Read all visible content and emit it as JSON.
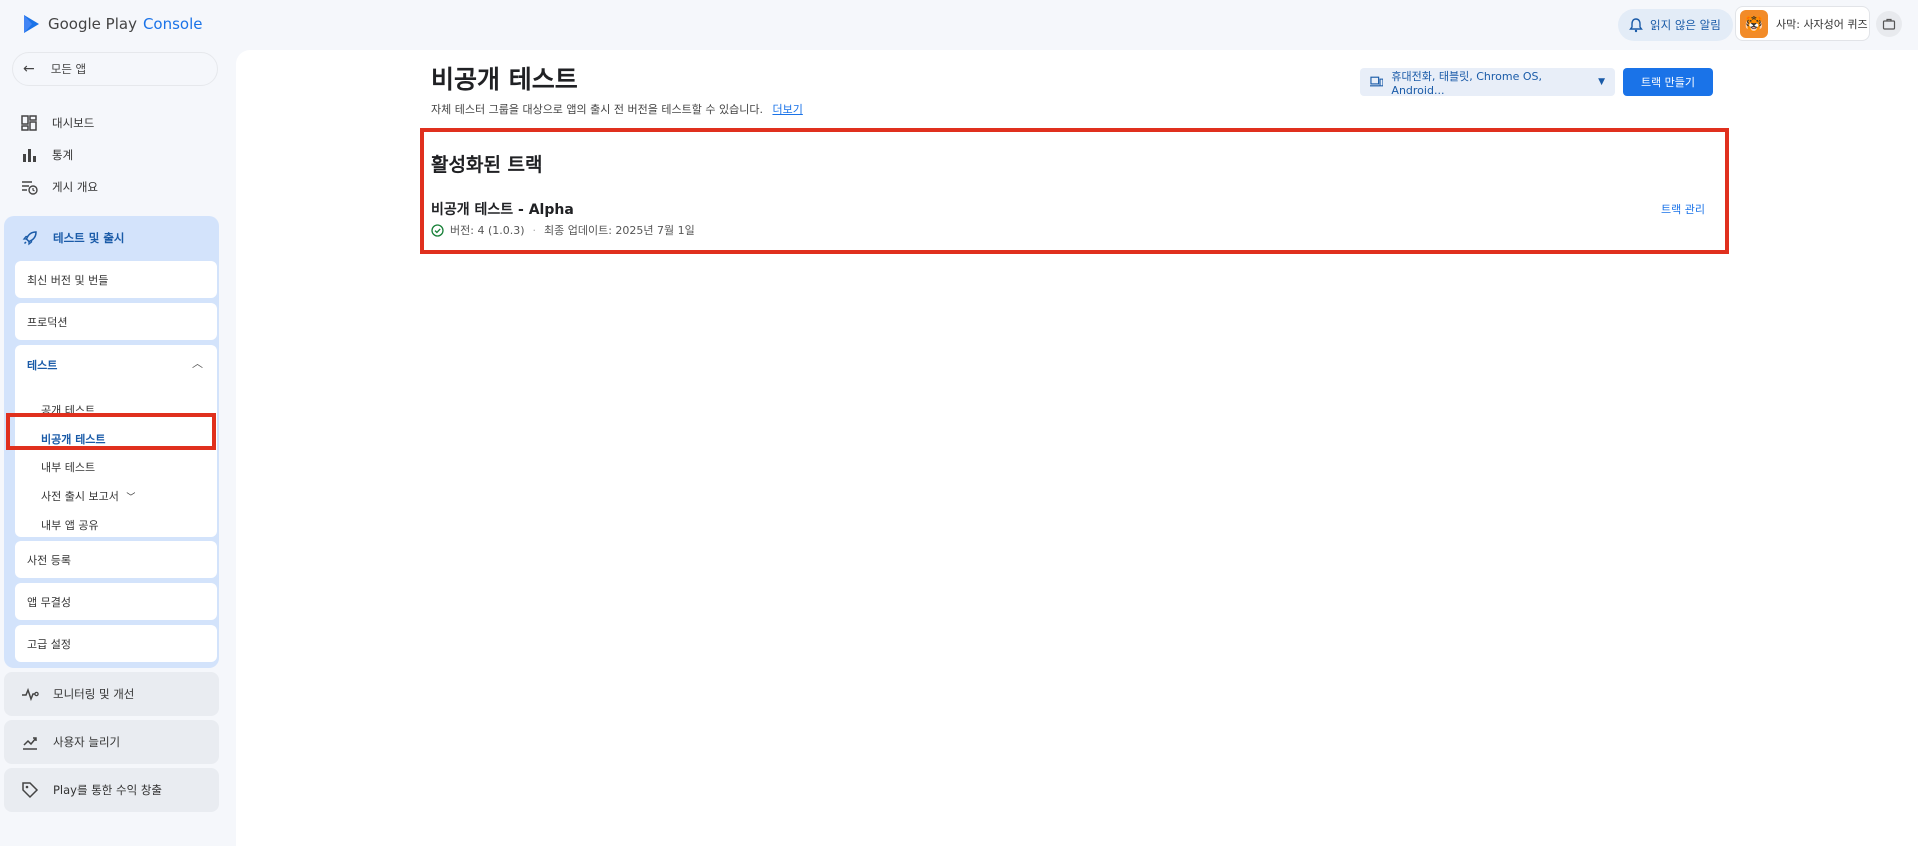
{
  "header": {
    "logo_brand": "Google Play",
    "logo_product": "Console",
    "notifications_label": "읽지 않은 알림",
    "account_name": "사막: 사자성어 퀴즈"
  },
  "sidebar": {
    "back_label": "모든 앱",
    "items": [
      {
        "label": "대시보드"
      },
      {
        "label": "통계"
      },
      {
        "label": "게시 개요"
      }
    ],
    "test_release": {
      "label": "테스트 및 출시",
      "sub": {
        "latest_releases": "최신 버전 및 번들",
        "production": "프로덕션",
        "testing": "테스트",
        "open_testing": "공개 테스트",
        "closed_testing": "비공개 테스트",
        "internal_testing": "내부 테스트",
        "pre_launch_report": "사전 출시 보고서",
        "internal_app_sharing": "내부 앱 공유",
        "pre_registration": "사전 등록",
        "app_integrity": "앱 무결성",
        "advanced_settings": "고급 설정"
      }
    },
    "monitor": "모니터링 및 개선",
    "grow_users": "사용자 늘리기",
    "monetize": "Play를 통한 수익 창출"
  },
  "main": {
    "title": "비공개 테스트",
    "description": "자체 테스터 그룹을 대상으로 앱의 출시 전 버전을 테스트할 수 있습니다.",
    "learn_more": "더보기",
    "device_select": "휴대전화, 태블릿, Chrome OS, Android...",
    "create_track": "트랙 만들기",
    "active_tracks_title": "활성화된 트랙",
    "track": {
      "name": "비공개 테스트 - Alpha",
      "version": "버전: 4 (1.0.3)",
      "updated": "최종 업데이트: 2025년 7월 1일",
      "manage": "트랙 관리"
    }
  },
  "colors": {
    "accent": "#1a73e8",
    "highlight": "#e0301e",
    "active_section_bg": "#d3e3fb"
  }
}
